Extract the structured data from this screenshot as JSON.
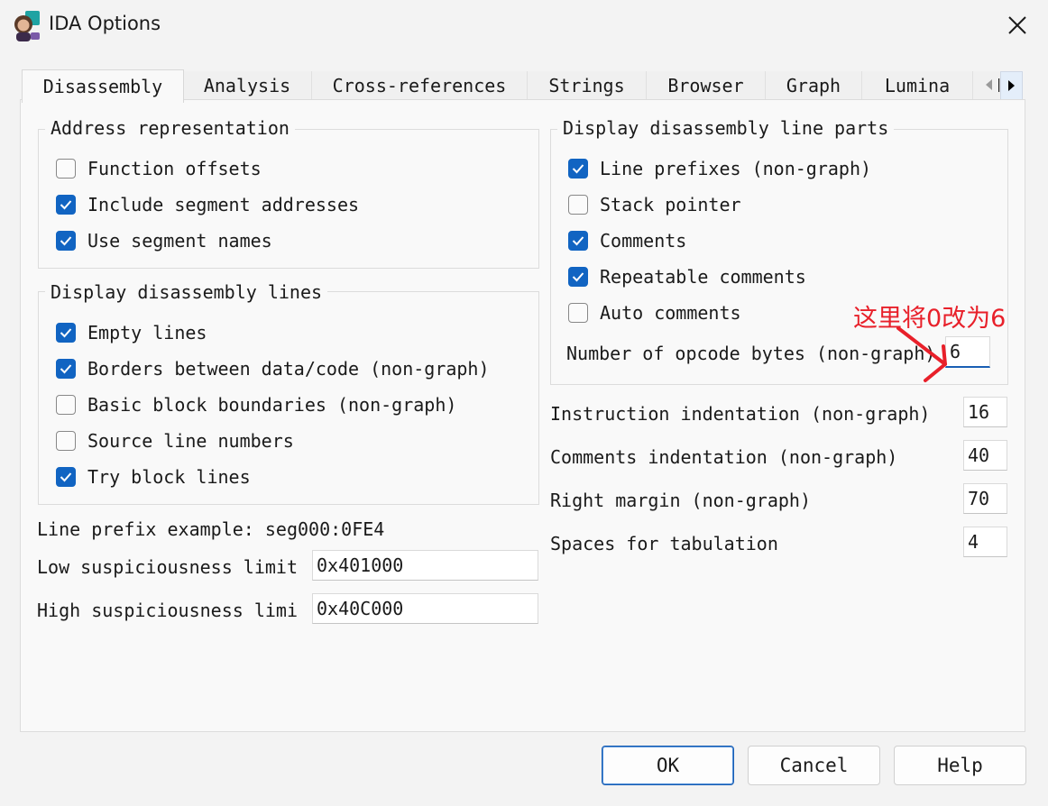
{
  "window": {
    "title": "IDA Options",
    "close_icon": "close-icon"
  },
  "tabs": [
    {
      "label": "Disassembly",
      "active": true
    },
    {
      "label": "Analysis"
    },
    {
      "label": "Cross-references"
    },
    {
      "label": "Strings"
    },
    {
      "label": "Browser"
    },
    {
      "label": "Graph"
    },
    {
      "label": "Lumina"
    },
    {
      "label": "M"
    }
  ],
  "address_repr": {
    "title": "Address representation",
    "items": [
      {
        "label": "Function offsets",
        "checked": false
      },
      {
        "label": "Include segment addresses",
        "checked": true
      },
      {
        "label": "Use segment names",
        "checked": true
      }
    ]
  },
  "disasm_lines": {
    "title": "Display disassembly lines",
    "items": [
      {
        "label": "Empty lines",
        "checked": true
      },
      {
        "label": "Borders between data/code (non-graph)",
        "checked": true
      },
      {
        "label": "Basic block boundaries (non-graph)",
        "checked": false
      },
      {
        "label": "Source line numbers",
        "checked": false
      },
      {
        "label": "Try block lines",
        "checked": true
      }
    ]
  },
  "line_prefix_example": "Line prefix example: seg000:0FE4",
  "low_susp": {
    "label": "Low suspiciousness limit",
    "value": "0x401000"
  },
  "high_susp": {
    "label": "High suspiciousness limi",
    "value": "0x40C000"
  },
  "line_parts": {
    "title": "Display disassembly line parts",
    "items": [
      {
        "label": "Line prefixes (non-graph)",
        "checked": true
      },
      {
        "label": "Stack pointer",
        "checked": false
      },
      {
        "label": "Comments",
        "checked": true
      },
      {
        "label": "Repeatable comments",
        "checked": true
      },
      {
        "label": "Auto comments",
        "checked": false
      }
    ],
    "opcode_label": "Number of opcode bytes (non-graph)",
    "opcode_value": "6"
  },
  "indent": [
    {
      "label": "Instruction indentation (non-graph)",
      "value": "16"
    },
    {
      "label": "Comments indentation (non-graph)",
      "value": "40"
    },
    {
      "label": "Right margin (non-graph)",
      "value": "70"
    },
    {
      "label": "Spaces for tabulation",
      "value": "4"
    }
  ],
  "buttons": {
    "ok": "OK",
    "cancel": "Cancel",
    "help": "Help"
  },
  "annotation": {
    "text": "这里将0改为6",
    "color": "#e8202a"
  },
  "colors": {
    "accent": "#1164c2",
    "background": "#f3f3f3"
  }
}
